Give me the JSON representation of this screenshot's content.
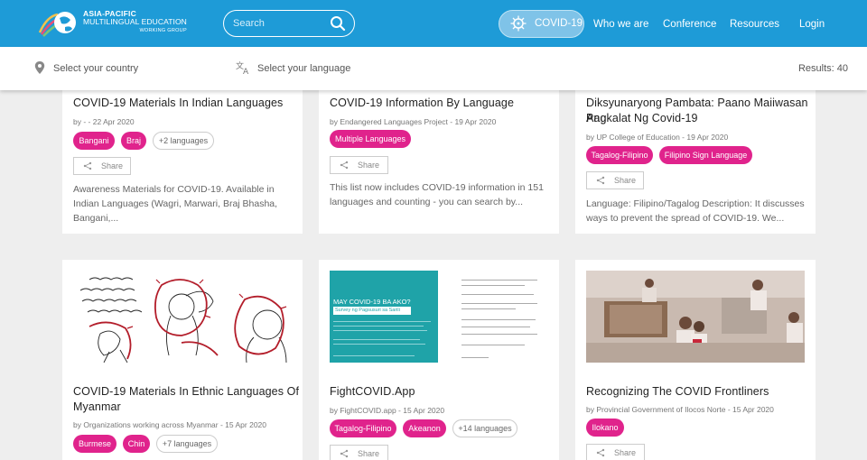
{
  "header": {
    "logo_line1": "ASIA-PACIFIC",
    "logo_line2": "MULTILINGUAL EDUCATION",
    "logo_line3": "WORKING GROUP",
    "search_placeholder": "Search",
    "covid_label": "COVID-19",
    "nav": [
      "Who we are",
      "Conference",
      "Resources",
      "Login"
    ]
  },
  "filters": {
    "country_label": "Select your country",
    "language_label": "Select your language",
    "results": "Results: 40"
  },
  "share_label": "Share",
  "cards": [
    {
      "title": "COVID-19 Materials In Indian Languages",
      "meta": "by - - 22 Apr 2020",
      "tags": [
        "Bangani",
        "Braj"
      ],
      "more": "+2 languages",
      "desc": "Awareness Materials for COVID-19. Available in Indian Languages (Wagri, Marwari, Braj Bhasha, Bangani,..."
    },
    {
      "title": "COVID-19 Information By Language",
      "meta": "by Endangered Languages Project - 19 Apr 2020",
      "tags": [
        "Multiple Languages"
      ],
      "desc": "This list now includes COVID-19 information in 151 languages and counting - you can search by..."
    },
    {
      "title_line1": "Diksyunaryong Pambata: Paano Maiiwasan Ang",
      "title_line2": "Pagkalat Ng Covid-19",
      "meta": "by UP College of Education - 19 Apr 2020",
      "tags": [
        "Tagalog-Filipino",
        "Filipino Sign Language"
      ],
      "desc": "Language: Filipino/Tagalog Description: It discusses ways to prevent the spread of COVID-19. We..."
    },
    {
      "title_line1": "COVID-19 Materials In Ethnic Languages Of",
      "title_line2": "Myanmar",
      "meta": "by Organizations working across Myanmar - 15 Apr 2020",
      "tags": [
        "Burmese",
        "Chin"
      ],
      "more": "+7 languages"
    },
    {
      "title": "FightCOVID.App",
      "meta": "by FightCOVID.app - 15 Apr 2020",
      "tags": [
        "Tagalog-Filipino",
        "Akeanon"
      ],
      "more": "+14 languages",
      "thumb_heading": "MAY COVID-19 BA AKO?",
      "thumb_sub": "Survey ng Pagsusuri sa Sarili"
    },
    {
      "title": "Recognizing The COVID Frontliners",
      "meta": "by Provincial Government of Ilocos Norte - 15 Apr 2020",
      "tags": [
        "Ilokano"
      ]
    }
  ],
  "colors": {
    "header": "#1e9bd7",
    "tag": "#e0238c"
  }
}
